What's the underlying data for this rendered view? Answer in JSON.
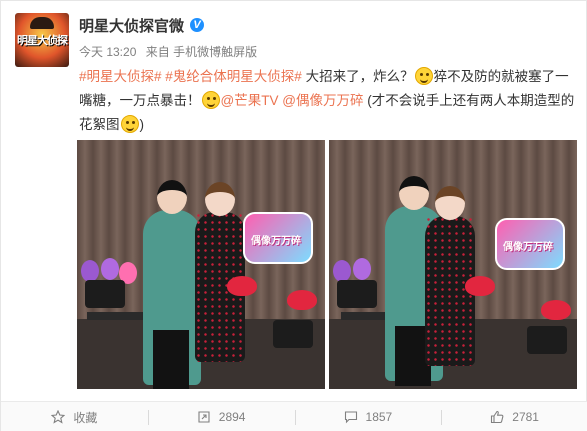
{
  "post": {
    "username": "明星大侦探官微",
    "verified_badge": "V",
    "avatar_logo_text": "明星大侦探",
    "time": "今天 13:20",
    "source_prefix": "来自",
    "source": "手机微博触屏版"
  },
  "content": {
    "tag1": "#明星大侦探#",
    "tag2": "#鬼纶合体明星大侦探#",
    "text1": " 大招来了，炸么？",
    "text2": "猝不及防的就被塞了一嘴糖，一万点暴击！",
    "mention1": "@芒果TV",
    "mention2": "@偶像万万碎",
    "text3": " (才不会说手上还有两人本期造型的花絮图",
    "text4": ")",
    "emoji_name": "smile-emoji-icon"
  },
  "photos": {
    "sign_text": "偶像万万碎"
  },
  "actions": {
    "favorite_label": "收藏",
    "repost_count": "2894",
    "comment_count": "1857",
    "like_count": "2781"
  },
  "colors": {
    "link": "#eb7350",
    "verified": "#1e90ff",
    "muted": "#808080"
  }
}
